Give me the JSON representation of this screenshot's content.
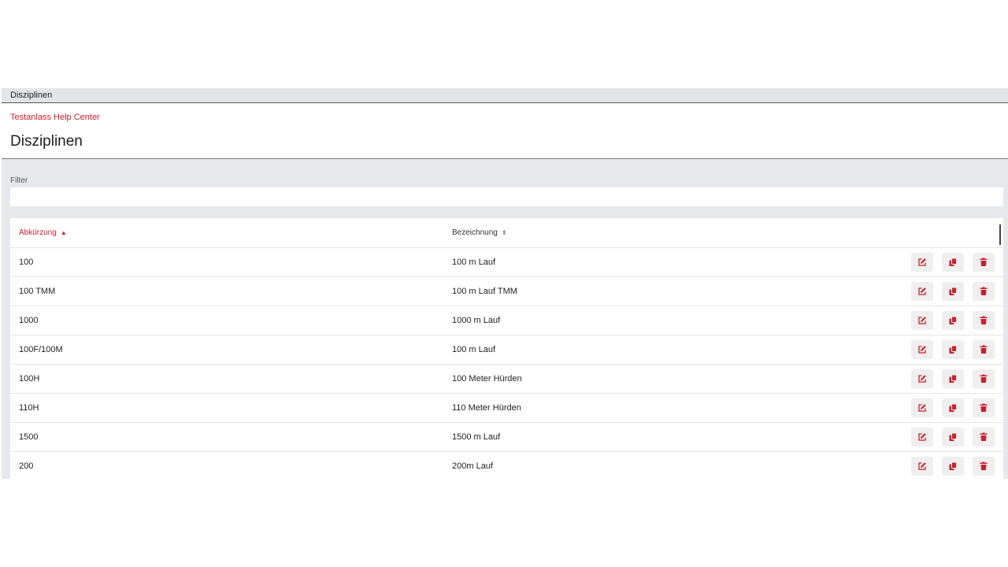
{
  "tab": {
    "label": "Disziplinen"
  },
  "header": {
    "breadcrumb": "Testanlass Help Center",
    "title": "Disziplinen"
  },
  "filter": {
    "label": "Filter",
    "value": "",
    "placeholder": ""
  },
  "table": {
    "columns": [
      "Abkürzung",
      "Bezeichnung"
    ],
    "sort": {
      "column": "Abkürzung",
      "direction": "ascending"
    },
    "rows": [
      [
        "100",
        "100 m Lauf"
      ],
      [
        "100 TMM",
        "100 m Lauf TMM"
      ],
      [
        "1000",
        "1000 m Lauf"
      ],
      [
        "100F/100M",
        "100 m Lauf"
      ],
      [
        "100H",
        "100 Meter Hürden"
      ],
      [
        "110H",
        "110 Meter Hürden"
      ],
      [
        "1500",
        "1500 m Lauf"
      ],
      [
        "200",
        "200m Lauf"
      ]
    ],
    "row_actions": [
      "edit-icon",
      "copy-icon",
      "trash-icon"
    ]
  },
  "colors": {
    "accent": "#cc1f2d",
    "background": "#e7e8ec"
  }
}
